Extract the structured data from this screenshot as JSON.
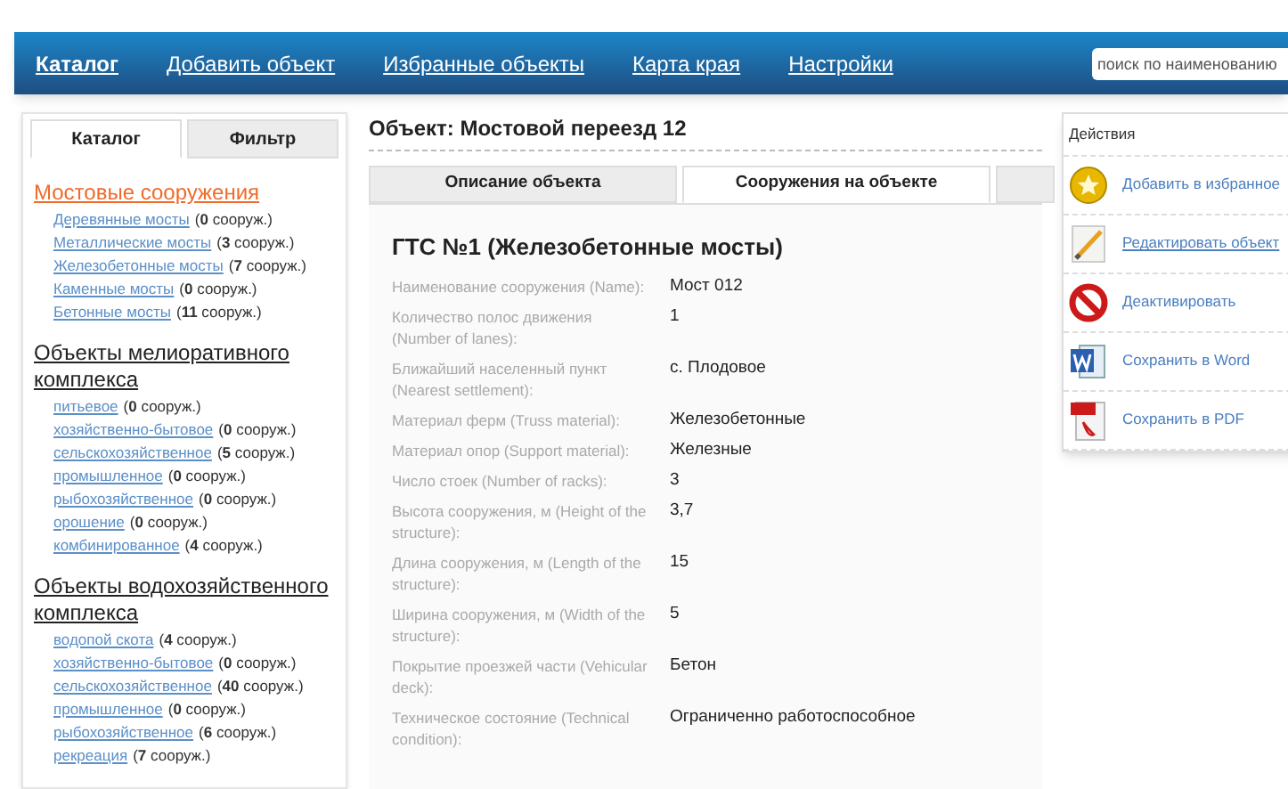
{
  "nav": {
    "items": [
      {
        "label": "Каталог",
        "selected": true
      },
      {
        "label": "Добавить объект",
        "selected": false
      },
      {
        "label": "Избранные объекты",
        "selected": false
      },
      {
        "label": "Карта края",
        "selected": false
      },
      {
        "label": "Настройки",
        "selected": false
      }
    ],
    "search": {
      "placeholder": "поиск по наименованию"
    }
  },
  "sidebar": {
    "tabs": [
      {
        "label": "Каталог",
        "selected": true
      },
      {
        "label": "Фильтр",
        "selected": false
      }
    ],
    "groups": [
      {
        "title": "Мостовые сооружения",
        "selected": true,
        "items": [
          {
            "label": "Деревянные мосты",
            "count": "(**0** сооруж.)"
          },
          {
            "label": "Металлические мосты",
            "count": "(**3** сооруж.)"
          },
          {
            "label": "Железобетонные мосты",
            "count": "(**7** сооруж.)"
          },
          {
            "label": "Каменные мосты",
            "count": "(**0** сооруж.)"
          },
          {
            "label": "Бетонные мосты",
            "count": "(**11** сооруж.)"
          }
        ]
      },
      {
        "title": "Объекты мелиоративного комплекса",
        "selected": false,
        "items": [
          {
            "label": "питьевое",
            "count": "(**0** сооруж.)"
          },
          {
            "label": "хозяйственно-бытовое",
            "count": "(**0** сооруж.)"
          },
          {
            "label": "сельскохозяйственное",
            "count": "(**5** сооруж.)"
          },
          {
            "label": "промышленное",
            "count": "(**0** сооруж.)"
          },
          {
            "label": "рыбохозяйственное",
            "count": "(**0** сооруж.)"
          },
          {
            "label": "орошение",
            "count": "(**0** сооруж.)"
          },
          {
            "label": "комбинированное",
            "count": "(**4** сооруж.)"
          }
        ]
      },
      {
        "title": "Объекты водохозяйственного комплекса",
        "selected": false,
        "items": [
          {
            "label": "водопой скота",
            "count": "(**4** сооруж.)"
          },
          {
            "label": "хозяйственно-бытовое",
            "count": "(**0** сооруж.)"
          },
          {
            "label": "сельскохозяйственное",
            "count": "(**40** сооруж.)"
          },
          {
            "label": "промышленное",
            "count": "(**0** сооруж.)"
          },
          {
            "label": "рыбохозяйственное",
            "count": "(**6** сооруж.)"
          },
          {
            "label": "рекреация",
            "count": "(**7** сооруж.)"
          }
        ]
      }
    ]
  },
  "object": {
    "title": "Объект: Мостовой переезд 12",
    "tabs": [
      {
        "label": "Описание объекта",
        "selected": false
      },
      {
        "label": "Сооружения на объекте",
        "selected": true
      },
      {
        "selected": false
      }
    ],
    "heading": "ГТС №1 (Железобетонные мосты)",
    "fields": [
      {
        "label": "Наименование сооружения (Name):",
        "value": "Мост 012"
      },
      {
        "label": "Количество полос движения (Number of lanes):",
        "value": "1"
      },
      {
        "label": "Ближайший населенный пункт (Nearest settlement):",
        "value": "с. Плодовое"
      },
      {
        "label": "Материал ферм (Truss material):",
        "value": "Железобетонные"
      },
      {
        "label": "Материал опор (Support material):",
        "value": "Железные"
      },
      {
        "label": "Число стоек (Number of racks):",
        "value": "3"
      },
      {
        "label": "Высота сооружения, м (Height of the structure):",
        "value": "3,7"
      },
      {
        "label": "Длина сооружения, м (Length of the structure):",
        "value": "15"
      },
      {
        "label": "Ширина сооружения, м (Width of the structure):",
        "value": "5"
      },
      {
        "label": "Покрытие проезжей части (Vehicular deck):",
        "value": "Бетон"
      },
      {
        "label": "Техническое состояние (Technical condition):",
        "value": "Ограниченно работоспособное"
      }
    ]
  },
  "actions": {
    "title": "Действия",
    "items": [
      {
        "kind": "favorite",
        "label": "Добавить в избранное",
        "hovered": false
      },
      {
        "kind": "edit",
        "label": "Редактировать объект",
        "hovered": true
      },
      {
        "kind": "deactivate",
        "label": "Деактивировать",
        "hovered": false
      },
      {
        "kind": "word",
        "label": "Сохранить в Word",
        "hovered": false
      },
      {
        "kind": "pdf",
        "label": "Сохранить в PDF",
        "hovered": false
      }
    ]
  }
}
